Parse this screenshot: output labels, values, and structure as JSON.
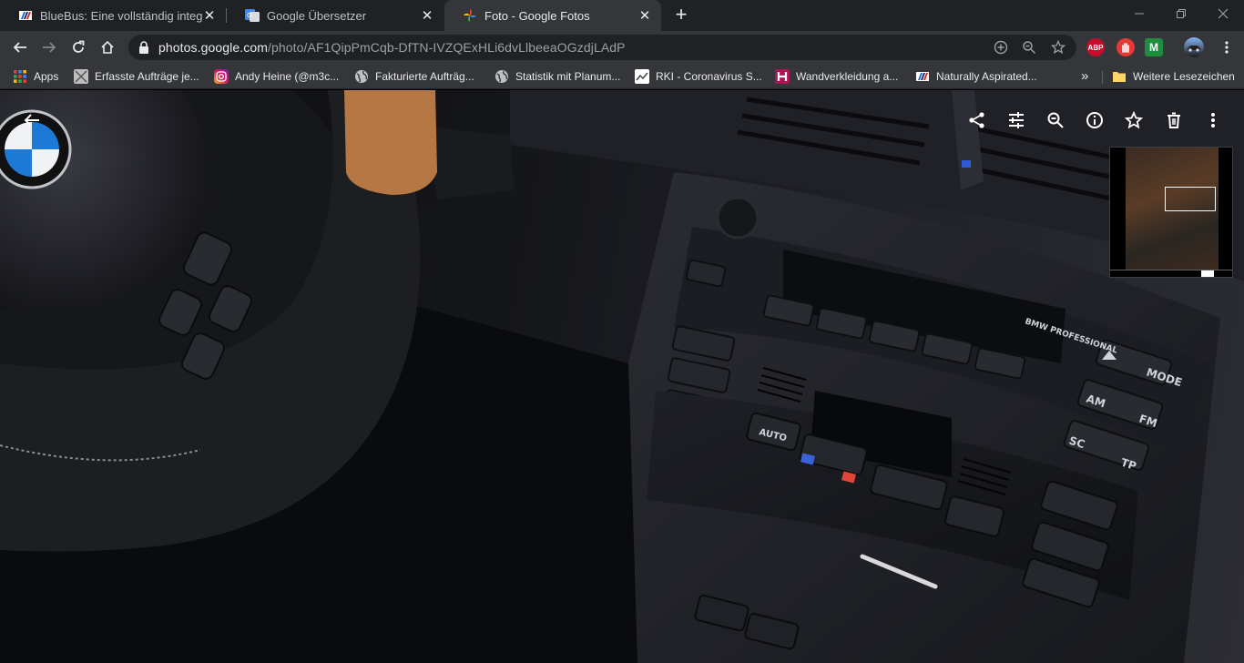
{
  "tabs": [
    {
      "title": "BlueBus: Eine vollständig integrie",
      "close": "✕",
      "icon": "bmw-stripe-icon"
    },
    {
      "title": "Google Übersetzer",
      "close": "✕",
      "icon": "google-translate-icon"
    },
    {
      "title": "Foto - Google Fotos",
      "close": "✕",
      "icon": "google-photos-icon",
      "active": true
    }
  ],
  "new_tab": "+",
  "window": {
    "minimize": "minimize-icon",
    "restore": "restore-icon",
    "close": "close-icon"
  },
  "toolbar": {
    "url_host": "photos.google.com",
    "url_path": "/photo/AF1QipPmCqb-DfTN-IVZQExHLi6dvLlbeeaOGzdjLAdP",
    "extensions": [
      {
        "label": "ABP",
        "color": "#c70d2c"
      },
      {
        "label": "",
        "color": "#e53935"
      },
      {
        "label": "M",
        "color": "#1e8e3e"
      }
    ]
  },
  "bookmarks": {
    "items": [
      {
        "label": "Apps",
        "icon": "apps-grid-icon"
      },
      {
        "label": "Erfasste Aufträge je...",
        "icon": "page-icon"
      },
      {
        "label": "Andy Heine (@m3c...",
        "icon": "instagram-icon"
      },
      {
        "label": "Fakturierte Aufträg...",
        "icon": "globe-icon"
      },
      {
        "label": "Statistik mit Planum...",
        "icon": "globe-icon"
      },
      {
        "label": "RKI - Coronavirus S...",
        "icon": "rki-icon"
      },
      {
        "label": "Wandverkleidung a...",
        "icon": "h-icon"
      },
      {
        "label": "Naturally Aspirated...",
        "icon": "bmw-stripe-icon"
      }
    ],
    "more": "»",
    "other": {
      "label": "Weitere Lesezeichen",
      "icon": "folder-icon"
    }
  },
  "photo": {
    "actions": [
      "share-icon",
      "edit-icon",
      "zoom-icon",
      "info-icon",
      "star-icon",
      "delete-icon",
      "more-icon"
    ],
    "panel_text": {
      "brand": "BMW PROFESSIONAL",
      "mode": "MODE",
      "am": "AM",
      "fm": "FM",
      "sc": "SC",
      "tp": "TP",
      "auto": "AUTO"
    }
  }
}
